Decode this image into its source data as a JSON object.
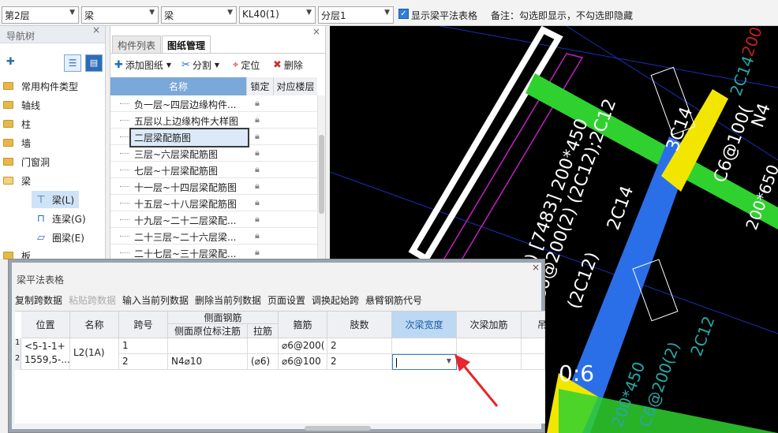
{
  "toolbar": {
    "floor": "第2层",
    "category": "梁",
    "type": "梁",
    "element": "KL40(1)",
    "layer": "分层1",
    "show_table_label": "显示梁平法表格",
    "remark": "备注：勾选即显示，不勾选即隐藏"
  },
  "nav": {
    "title": "导航树",
    "items": [
      "常用构件类型",
      "轴线",
      "柱",
      "墙",
      "门窗洞",
      "梁",
      "板"
    ],
    "beam_children": [
      "梁(L)",
      "连梁(G)",
      "圈梁(E)"
    ]
  },
  "drawings": {
    "tabs": [
      "构件列表",
      "图纸管理"
    ],
    "actions": [
      "添加图纸",
      "分割",
      "定位",
      "删除"
    ],
    "columns": [
      "名称",
      "锁定",
      "对应楼层"
    ],
    "rows": [
      "负一层~四层边缘构件...",
      "五层以上边缘构件大样图",
      "二层梁配筋图",
      "三层~六层梁配筋图",
      "七层~十层梁配筋图",
      "十一层~十四层梁配筋图",
      "十五层~十八层梁配筋图",
      "十九层~二十二层梁配...",
      "二十三层~二十六层梁...",
      "二十七层~三十层梁配..."
    ],
    "selected_index": 2
  },
  "dialog": {
    "title": "梁平法表格",
    "buttons": [
      "复制跨数据",
      "粘贴跨数据",
      "输入当前列数据",
      "删除当前列数据",
      "页面设置",
      "调换起始跨",
      "悬臂钢筋代号"
    ],
    "disabled_button_index": 1,
    "headers": {
      "position": "位置",
      "name": "名称",
      "span": "跨号",
      "side_group": "侧面钢筋",
      "side_mark": "侧面原位标注筋",
      "tie": "拉筋",
      "stirrup": "箍筋",
      "legs": "肢数",
      "sec_width": "次梁宽度",
      "sec_bar": "次梁加筋",
      "more": "吊"
    },
    "rows": [
      {
        "num": "1",
        "position": "<5-1-1+",
        "name": "L2(1A)",
        "span": "1",
        "side": "",
        "tie": "",
        "stirrup": "⌀6@200(",
        "legs": "2"
      },
      {
        "num": "2",
        "position": "1559,5-...",
        "name": "",
        "span": "2",
        "side": "N4⌀10",
        "tie": "(⌀6)",
        "stirrup": "⌀6@100",
        "legs": "2"
      }
    ]
  },
  "cad": {
    "labels": [
      "L2(1A) [7483] 200*450",
      "C6@200(2) (2C12);2C12",
      "(2C12)",
      "2C14",
      "3C14",
      "C6@100(",
      "200*650",
      "N4",
      "0:6",
      "2C14",
      "200*450",
      "C6@200(2)",
      "2C12",
      "200*450"
    ]
  },
  "colors": {
    "accent": "#2f7fd8",
    "cad_green": "#2fd12f",
    "cad_blue": "#2b6fe8",
    "cad_yellow": "#f2e600",
    "arrow_red": "#e8252a"
  }
}
